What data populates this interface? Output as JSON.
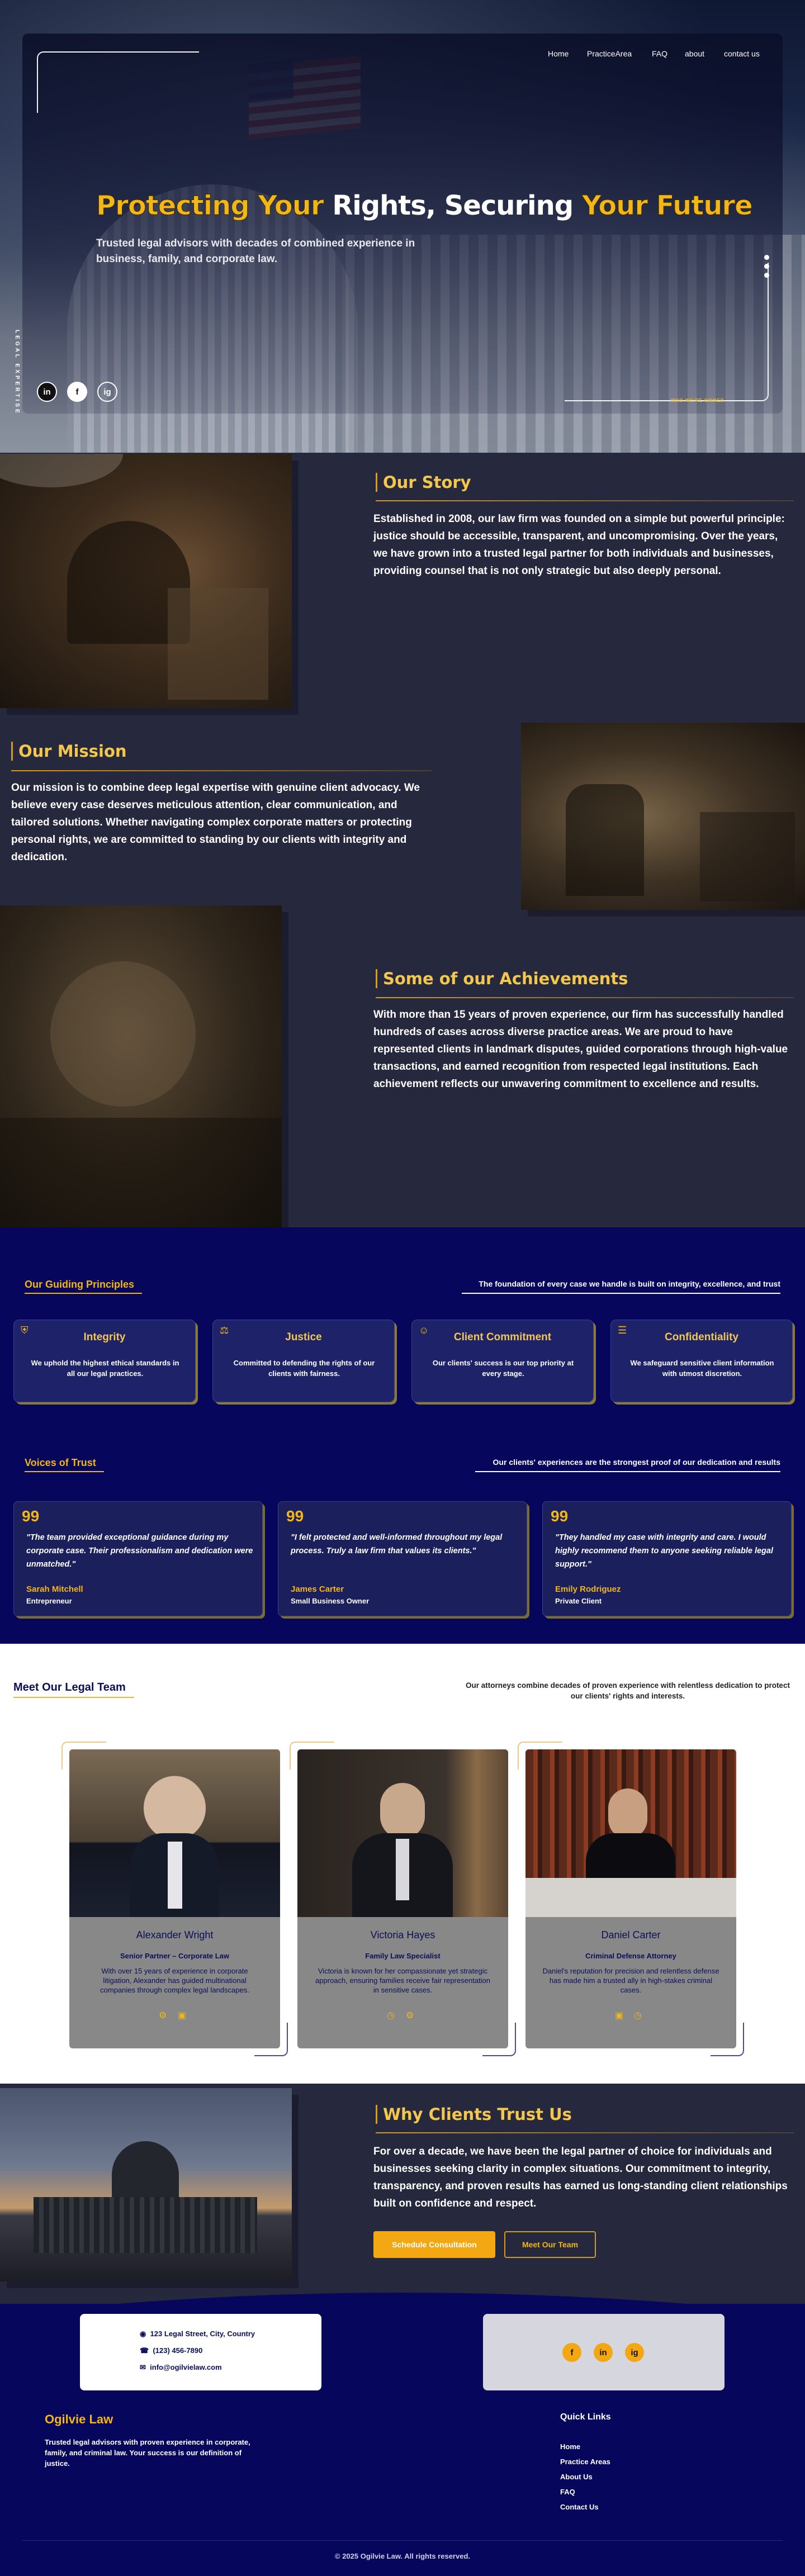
{
  "nav": {
    "items": [
      "Home",
      "PracticeArea",
      "FAQ",
      "about",
      "contact us"
    ]
  },
  "hero": {
    "title_part1": "Protecting Your",
    "title_part2": "Rights, Securing",
    "title_part3": "Your Future",
    "subtitle": "Trusted legal advisors with decades of combined experience in business, family, and corporate law.",
    "vertical_label": "LEGAL EXPERTISE",
    "mini_label": "WHO WE'RE OWNED",
    "social": [
      "in",
      "f",
      "ig"
    ]
  },
  "story": {
    "title": "Our Story",
    "text": "Established in 2008, our law firm was founded on a simple but powerful principle: justice should be accessible, transparent, and uncompromising. Over the years, we have grown into a trusted legal partner for both individuals and businesses, providing counsel that is not only strategic but also deeply personal."
  },
  "mission": {
    "title": "Our Mission",
    "text": "Our mission is to combine deep legal expertise with genuine client advocacy. We believe every case deserves meticulous attention, clear communication, and tailored solutions. Whether navigating complex corporate matters or protecting personal rights, we are committed to standing by our clients with integrity and dedication."
  },
  "achievements": {
    "title": "Some of our Achievements",
    "text": "With more than 15 years of proven experience, our firm has successfully handled hundreds of cases across diverse practice areas. We are proud to have represented clients in landmark disputes, guided corporations through high-value transactions, and earned recognition from respected legal institutions. Each achievement reflects our unwavering commitment to excellence and results."
  },
  "principles": {
    "title": "Our Guiding Principles",
    "tagline": "The foundation of every case we handle is built on integrity, excellence, and trust",
    "cards": [
      {
        "title": "Integrity",
        "text": "We uphold the highest ethical standards in all our legal practices.",
        "icon": "shield-icon"
      },
      {
        "title": "Justice",
        "text": "Committed to defending the rights of our clients with fairness.",
        "icon": "scales-icon"
      },
      {
        "title": "Client Commitment",
        "text": "Our clients' success is our top priority at every stage.",
        "icon": "people-icon"
      },
      {
        "title": "Confidentiality",
        "text": "We safeguard sensitive client information with utmost discretion.",
        "icon": "document-icon"
      }
    ]
  },
  "voices": {
    "title": "Voices of Trust",
    "tagline": "Our clients' experiences are the strongest proof of our dedication and results",
    "quote_mark": "99",
    "cards": [
      {
        "quote": "\"The team provided exceptional guidance during my corporate case. Their professionalism and dedication were unmatched.\"",
        "name": "Sarah Mitchell",
        "role": "Entrepreneur"
      },
      {
        "quote": "\"I felt protected and well-informed throughout my legal process. Truly a law firm that values its clients.\"",
        "name": "James Carter",
        "role": "Small Business Owner"
      },
      {
        "quote": "\"They handled my case with integrity and care. I would highly recommend them to anyone seeking reliable legal support.\"",
        "name": "Emily Rodriguez",
        "role": "Private Client"
      }
    ]
  },
  "team": {
    "title": "Meet Our Legal Team",
    "tagline": "Our attorneys combine decades of proven experience with relentless dedication to protect our clients' rights and interests.",
    "members": [
      {
        "name": "Alexander Wright",
        "role": "Senior Partner – Corporate Law",
        "text": "With over 15 years of experience in corporate litigation, Alexander has guided multinational companies through complex legal landscapes."
      },
      {
        "name": "Victoria Hayes",
        "role": "Family Law Specialist",
        "text": "Victoria is known for her compassionate yet strategic approach, ensuring families receive fair representation in sensitive cases."
      },
      {
        "name": "Daniel Carter",
        "role": "Criminal Defense Attorney",
        "text": "Daniel's reputation for precision and relentless defense has made him a trusted ally in high-stakes criminal cases."
      }
    ]
  },
  "trust": {
    "title": "Why Clients Trust Us",
    "text": "For over a decade, we have been the legal partner of choice for individuals and businesses seeking clarity in complex situations. Our commitment to integrity, transparency, and proven results has earned us long-standing client relationships built on confidence and respect.",
    "cta_primary": "Schedule Consultation",
    "cta_secondary": "Meet Our Team"
  },
  "contact": {
    "address": "123 Legal Street, City, Country",
    "phone": "(123) 456-7890",
    "email": "info@ogilvielaw.com",
    "social": [
      "f",
      "in",
      "ig"
    ]
  },
  "footer": {
    "brand": "Ogilvie Law",
    "about": "Trusted legal advisors with proven experience in corporate, family, and criminal law. Your success is our definition of justice.",
    "links_title": "Quick Links",
    "links": [
      "Home",
      "Practice Areas",
      "About Us",
      "FAQ",
      "Contact Us"
    ],
    "copyright": "© 2025 Ogilvie Law. All rights reserved."
  },
  "colors": {
    "accent": "#f3b617",
    "navy": "#06075c",
    "slate": "#26283e"
  }
}
